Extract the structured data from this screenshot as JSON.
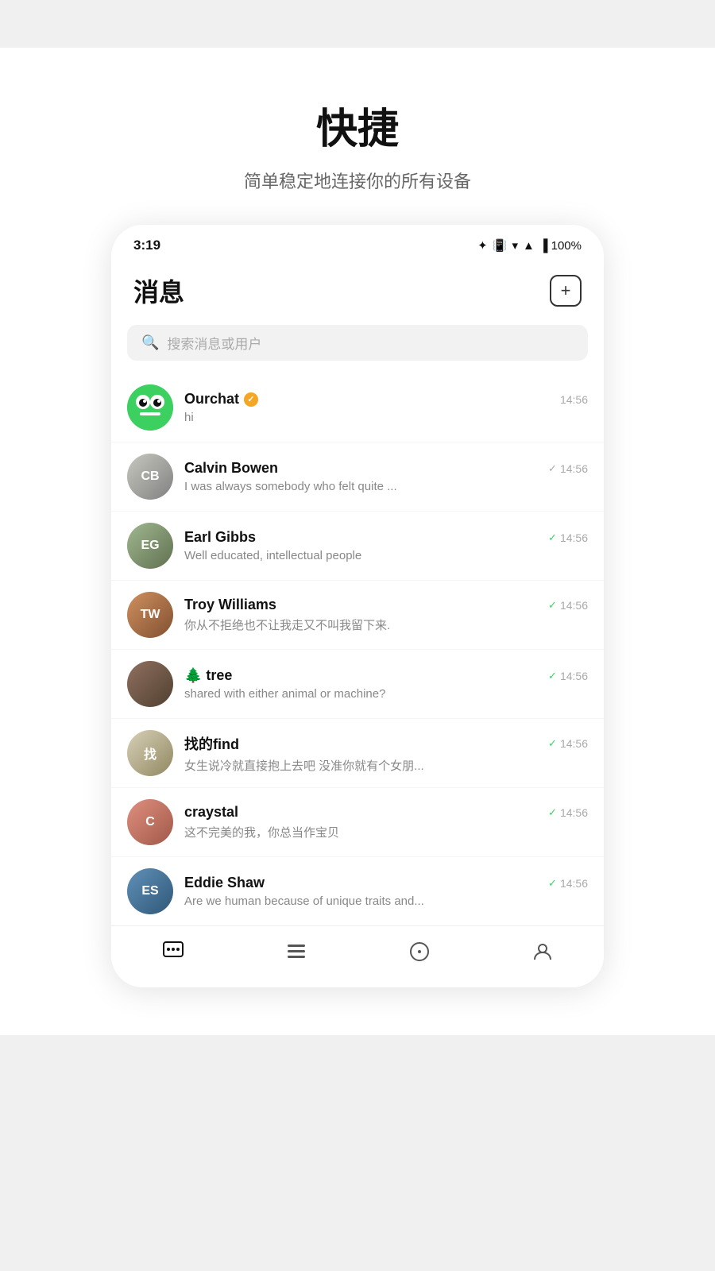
{
  "header": {
    "title": "快捷",
    "subtitle": "简单稳定地连接你的所有设备"
  },
  "statusBar": {
    "time": "3:19",
    "icons": "✦ 📳 ▾ ▲ 🔋 100%"
  },
  "app": {
    "title": "消息",
    "compose_label": "+"
  },
  "search": {
    "placeholder": "搜索消息或用户"
  },
  "chats": [
    {
      "id": "ourchat",
      "name": "Ourchat",
      "verified": true,
      "preview": "hi",
      "time": "14:56",
      "check": "none",
      "avatarType": "ourchat",
      "avatarBg": "#3cd060"
    },
    {
      "id": "calvin",
      "name": "Calvin Bowen",
      "verified": false,
      "preview": "I was always somebody who felt quite  ...",
      "time": "14:56",
      "check": "gray",
      "avatarType": "color",
      "avatarBg": "#b0b0b0",
      "avatarText": "CB"
    },
    {
      "id": "earl",
      "name": "Earl Gibbs",
      "verified": false,
      "preview": "Well educated, intellectual people",
      "time": "14:56",
      "check": "green",
      "avatarType": "color",
      "avatarBg": "#8a9e78",
      "avatarText": "EG"
    },
    {
      "id": "troy",
      "name": "Troy Williams",
      "verified": false,
      "preview": "你从不拒绝也不让我走又不叫我留下来.",
      "time": "14:56",
      "check": "green",
      "avatarType": "color",
      "avatarBg": "#c07848",
      "avatarText": "TW"
    },
    {
      "id": "tree",
      "name": "🌲 tree",
      "verified": false,
      "preview": "shared with either animal or machine?",
      "time": "14:56",
      "check": "green",
      "avatarType": "color",
      "avatarBg": "#7a5a40",
      "avatarText": ""
    },
    {
      "id": "zhaoddefind",
      "name": "找的find",
      "verified": false,
      "preview": "女生说冷就直接抱上去吧 没准你就有个女朋...",
      "time": "14:56",
      "check": "green",
      "avatarType": "color",
      "avatarBg": "#c8c0a0",
      "avatarText": "找"
    },
    {
      "id": "craystal",
      "name": "craystal",
      "verified": false,
      "preview": "这不完美的我，你总当作宝贝",
      "time": "14:56",
      "check": "green",
      "avatarType": "color",
      "avatarBg": "#d07868",
      "avatarText": "C"
    },
    {
      "id": "eddie",
      "name": "Eddie Shaw",
      "verified": false,
      "preview": "Are we human because of unique traits and...",
      "time": "14:56",
      "check": "green",
      "avatarType": "color",
      "avatarBg": "#4878a0",
      "avatarText": "ES"
    }
  ],
  "bottomNav": [
    {
      "id": "chat",
      "icon": "💬",
      "active": true,
      "label": "消息"
    },
    {
      "id": "contacts",
      "icon": "☰",
      "active": false,
      "label": "联系人"
    },
    {
      "id": "discover",
      "icon": "◯",
      "active": false,
      "label": "发现"
    },
    {
      "id": "profile",
      "icon": "👤",
      "active": false,
      "label": "我"
    }
  ]
}
